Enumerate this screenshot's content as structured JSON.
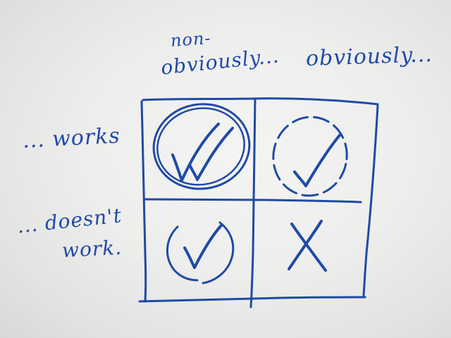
{
  "board": {
    "column_headers": {
      "col1_line1": "non-",
      "col1_line2": "obviously...",
      "col2": "obviously..."
    },
    "row_headers": {
      "row1": "... works",
      "row2_line1": "... doesn't",
      "row2_line2": "work."
    },
    "cells": [
      {
        "row": 1,
        "col": 1,
        "mark": "double-check",
        "enclosure": "double-circle"
      },
      {
        "row": 1,
        "col": 2,
        "mark": "check",
        "enclosure": "dashed-circle"
      },
      {
        "row": 2,
        "col": 1,
        "mark": "check",
        "enclosure": "parentheses"
      },
      {
        "row": 2,
        "col": 2,
        "mark": "cross",
        "enclosure": "none"
      }
    ],
    "marker_color": "#1f4aa6",
    "background_color": "#efefed"
  }
}
